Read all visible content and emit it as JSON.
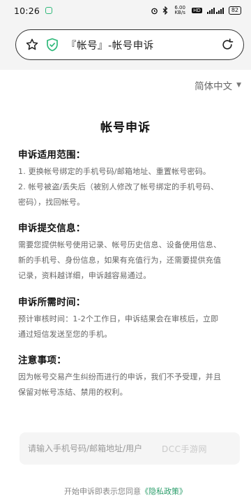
{
  "status_bar": {
    "time": "10:26",
    "net_speed": "6.00 KB/s",
    "hd_badge": "HD",
    "signal": "5G 4G",
    "battery": "82"
  },
  "browser": {
    "page_title": "『帐号』-帐号申诉"
  },
  "language_select": {
    "value": "简体中文"
  },
  "page": {
    "title": "帐号申诉",
    "sections": [
      {
        "title": "申诉适用范围：",
        "lines": [
          "1. 更换帐号绑定的手机号码/邮箱地址、重置帐号密码。",
          "2. 帐号被盗/丢失后（被别人修改了帐号绑定的手机号码、",
          "密码），找回帐号。"
        ]
      },
      {
        "title": "申诉提交信息：",
        "lines": [
          "需要您提供帐号使用记录、帐号历史信息、设备使用信息、",
          "新的手机号、身份信息，如果有充值行为，还需要提供充值",
          "记录，资料越详细，申诉越容易通过。"
        ]
      },
      {
        "title": "申诉所需时间：",
        "lines": [
          "预计审核时间：1-2个工作日，申诉结果会在审核后，立即",
          "通过短信发送至您的手机。"
        ]
      },
      {
        "title": "注意事项：",
        "lines": [
          "因为帐号交易产生纠纷而进行的申诉，我们不予受理，并且",
          "保留对帐号冻结、禁用的权利。"
        ]
      }
    ]
  },
  "input": {
    "placeholder": "请输入手机号码/邮箱地址/用户",
    "value": ""
  },
  "watermark": "DCC手游网",
  "footer": {
    "prefix": "开始申诉即表示您同意",
    "link": "《隐私政策》"
  }
}
